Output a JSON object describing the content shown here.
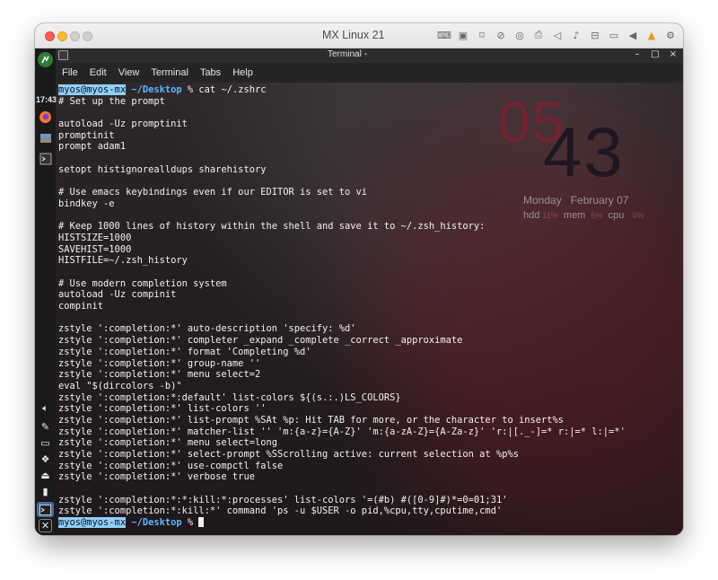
{
  "vm_window": {
    "title": "MX Linux 21",
    "toolbar_icons": [
      "keyboard-icon",
      "chip-icon",
      "usb-icon",
      "camera-off-icon",
      "network-icon",
      "printer-icon",
      "speaker-icon",
      "microphone-icon",
      "disk-icon",
      "video-icon",
      "play-icon",
      "warning-icon",
      "gear-icon"
    ]
  },
  "panel": {
    "time": "17:43",
    "launchers": [
      "mx-logo-icon",
      "firefox-icon",
      "files-icon",
      "terminal-icon"
    ],
    "tray": [
      "volume-icon",
      "clipboard-icon",
      "screen-icon",
      "dropbox-icon",
      "eject-icon",
      "battery-icon",
      "active-terminal-icon",
      "mx-menu-icon"
    ]
  },
  "terminal": {
    "title": "Terminal -",
    "controls": [
      "–",
      "□",
      "×"
    ],
    "menu": [
      "File",
      "Edit",
      "View",
      "Terminal",
      "Tabs",
      "Help"
    ],
    "prompt_user": "myos@myos-mx",
    "prompt_path": "~/Desktop",
    "command": " % cat ~/.zshrc",
    "lines": [
      "# Set up the prompt",
      "",
      "autoload -Uz promptinit",
      "promptinit",
      "prompt adam1",
      "",
      "setopt histignorealldups sharehistory",
      "",
      "# Use emacs keybindings even if our EDITOR is set to vi",
      "bindkey -e",
      "",
      "# Keep 1000 lines of history within the shell and save it to ~/.zsh_history:",
      "HISTSIZE=1000",
      "SAVEHIST=1000",
      "HISTFILE=~/.zsh_history",
      "",
      "# Use modern completion system",
      "autoload -Uz compinit",
      "compinit",
      "",
      "zstyle ':completion:*' auto-description 'specify: %d'",
      "zstyle ':completion:*' completer _expand _complete _correct _approximate",
      "zstyle ':completion:*' format 'Completing %d'",
      "zstyle ':completion:*' group-name ''",
      "zstyle ':completion:*' menu select=2",
      "eval \"$(dircolors -b)\"",
      "zstyle ':completion:*:default' list-colors ${(s.:.)LS_COLORS}",
      "zstyle ':completion:*' list-colors ''",
      "zstyle ':completion:*' list-prompt %SAt %p: Hit TAB for more, or the character to insert%s",
      "zstyle ':completion:*' matcher-list '' 'm:{a-z}={A-Z}' 'm:{a-zA-Z}={A-Za-z}' 'r:|[._-]=* r:|=* l:|=*'",
      "zstyle ':completion:*' menu select=long",
      "zstyle ':completion:*' select-prompt %SScrolling active: current selection at %p%s",
      "zstyle ':completion:*' use-compctl false",
      "zstyle ':completion:*' verbose true",
      "",
      "zstyle ':completion:*:*:kill:*:processes' list-colors '=(#b) #([0-9]#)*=0=01;31'",
      "zstyle ':completion:*:kill:*' command 'ps -u $USER -o pid,%cpu,tty,cputime,cmd'"
    ],
    "final_prompt_suffix": " % "
  },
  "conky": {
    "hour": "05",
    "minute": "43",
    "day": "Monday",
    "date": "February 07",
    "hdd_label": "hdd",
    "hdd_pct": "11%",
    "mem_label": "mem",
    "mem_pct": "5%",
    "cpu_label": "cpu",
    "cpu_pct": "0%"
  }
}
